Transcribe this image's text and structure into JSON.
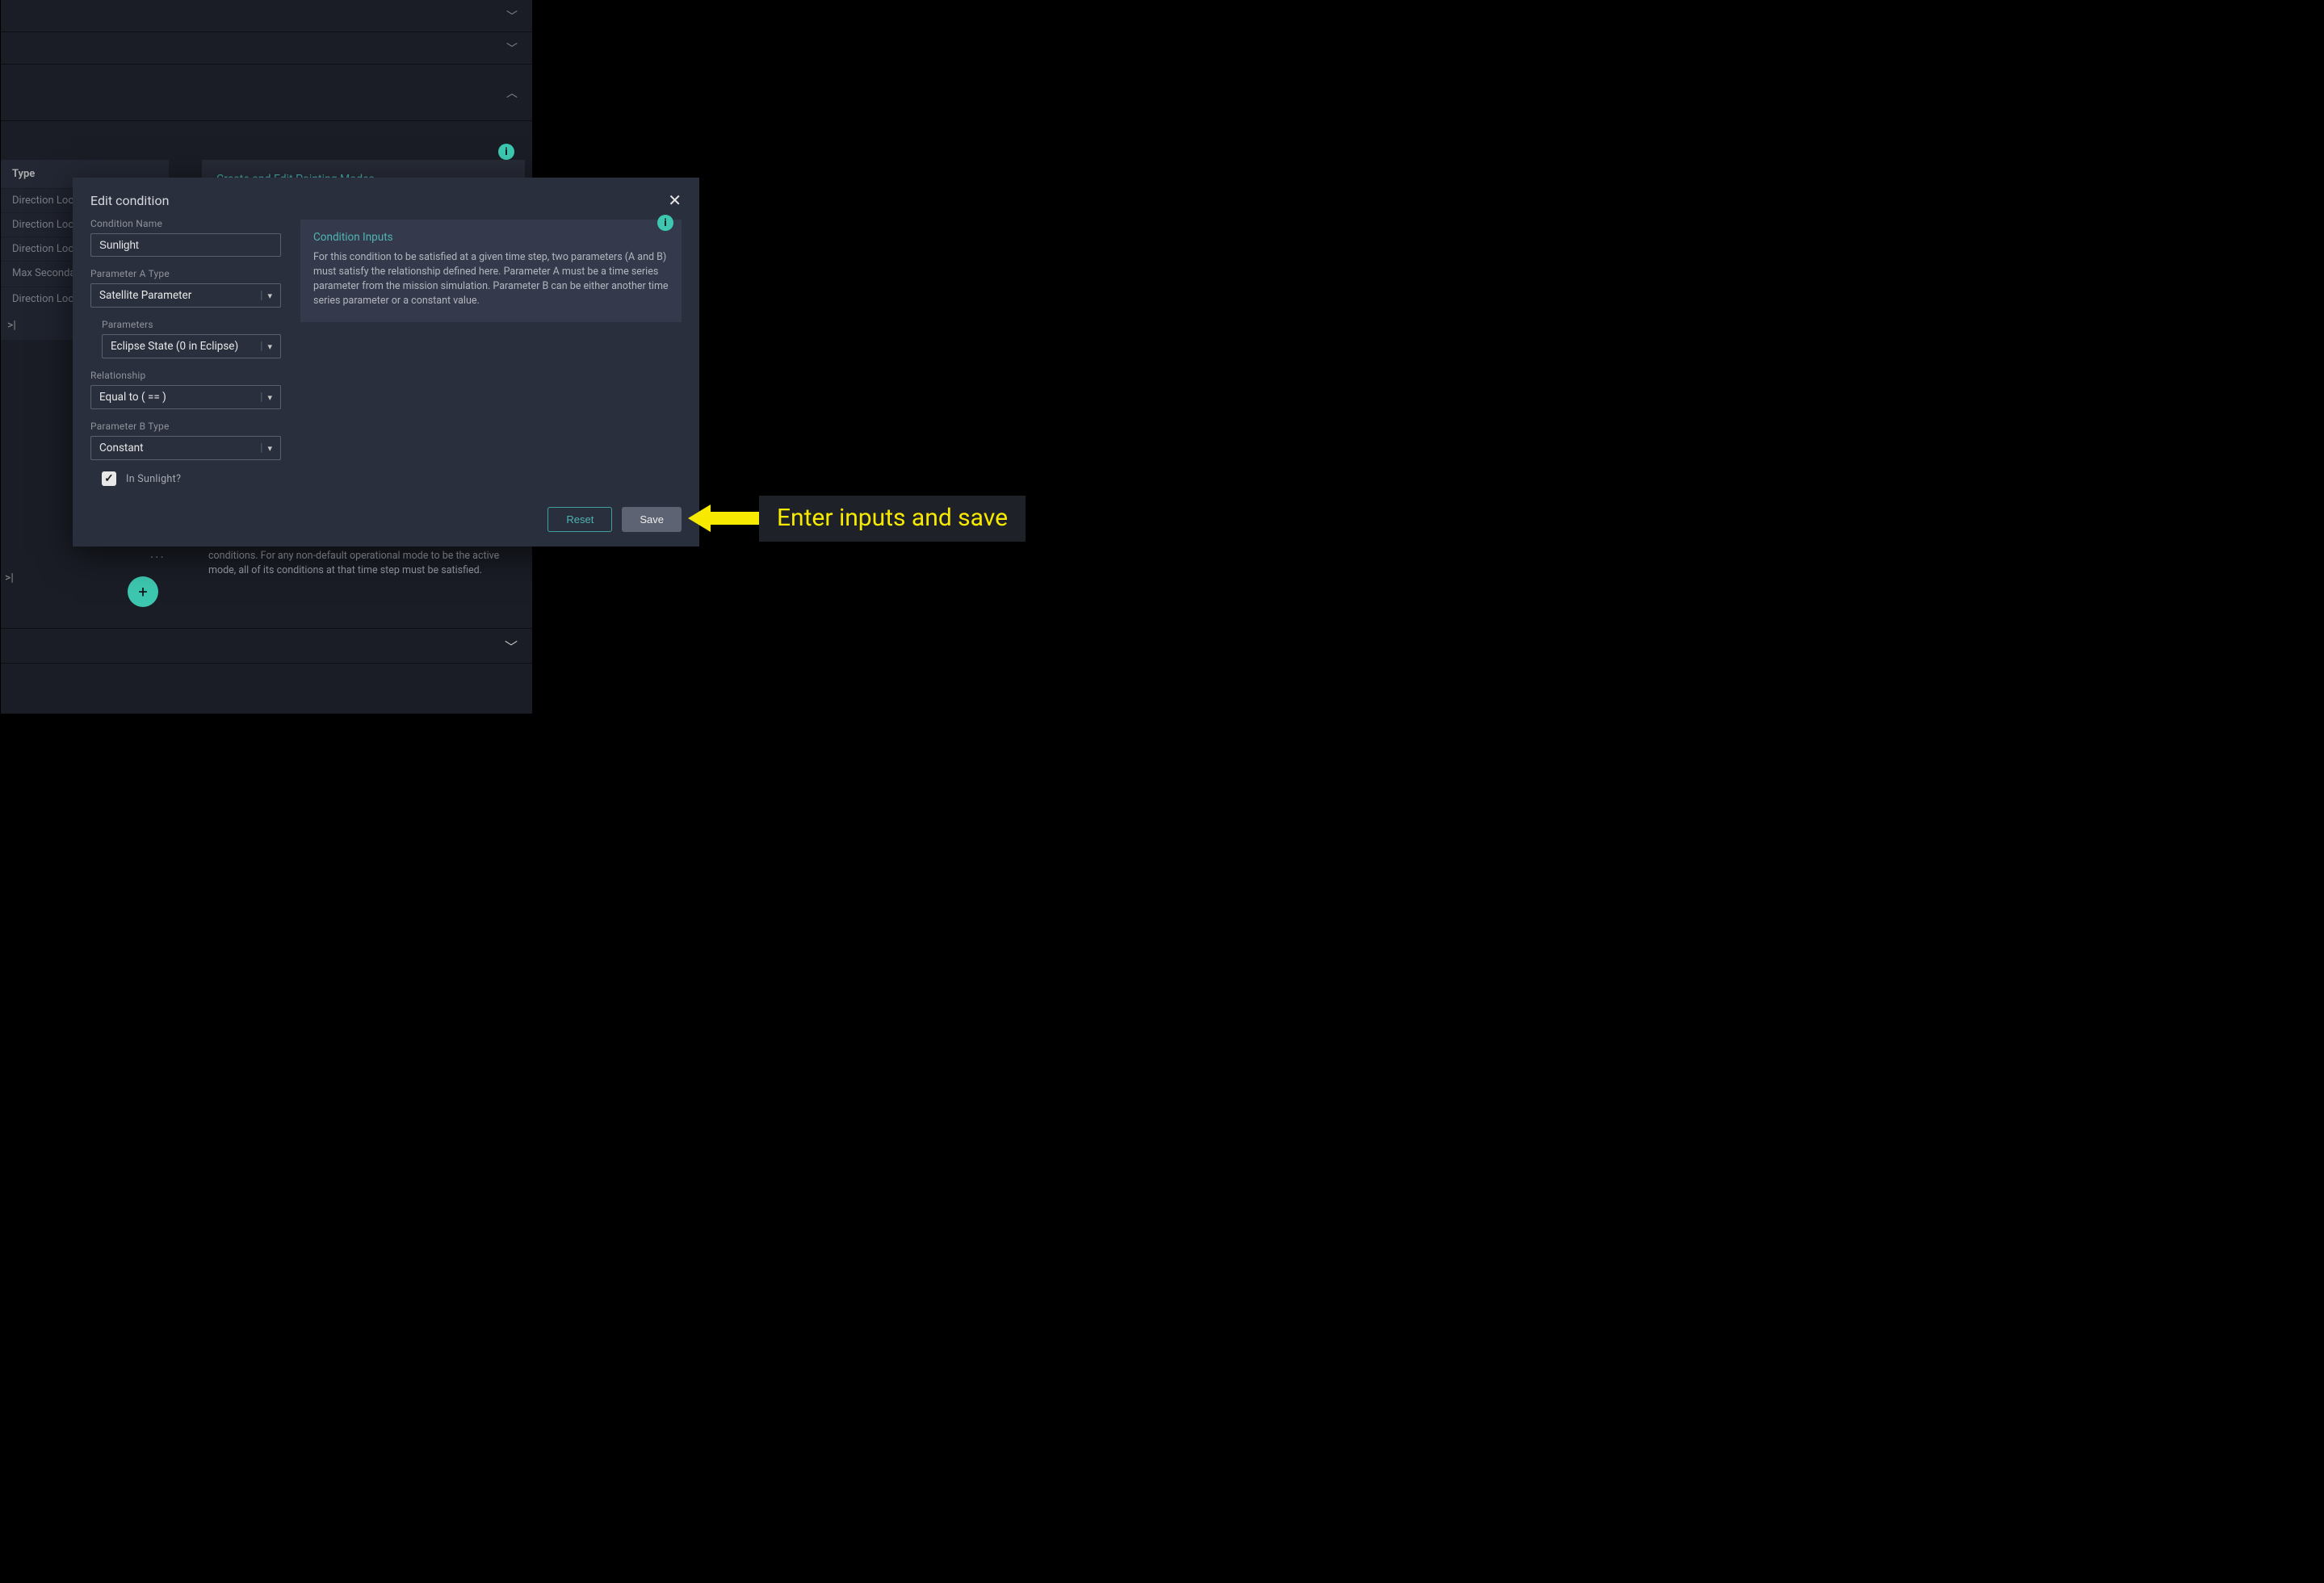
{
  "background": {
    "type_col_header": "Type",
    "rows": [
      "Direction Loc",
      "Direction Loc",
      "Direction Loc",
      "Max Secondary Alignment",
      "Direction Loc"
    ],
    "pager": ">|",
    "heading": "Create and Edit Pointing Modes",
    "bottom_text": "conditions. For any non-default operational mode to be the active mode, all of its conditions at that time step must be satisfied.",
    "fab": "+",
    "dots": "..."
  },
  "modal": {
    "title": "Edit condition",
    "fields": {
      "name_label": "Condition Name",
      "name_value": "Sunlight",
      "paramA_label": "Parameter A Type",
      "paramA_value": "Satellite Parameter",
      "parameters_label": "Parameters",
      "parameters_value": "Eclipse State (0 in Eclipse)",
      "relationship_label": "Relationship",
      "relationship_value": "Equal to ( == )",
      "paramB_label": "Parameter B Type",
      "paramB_value": "Constant",
      "checkbox_label": "In Sunlight?",
      "checkbox_checked": true
    },
    "info": {
      "title": "Condition Inputs",
      "text": "For this condition to be satisfied at a given time step, two parameters (A and B) must satisfy the relationship defined here. Parameter A must be a time series parameter from the mission simulation. Parameter B can be either another time series parameter or a constant value."
    },
    "buttons": {
      "reset": "Reset",
      "save": "Save"
    }
  },
  "annotation": {
    "text": "Enter inputs and save"
  }
}
